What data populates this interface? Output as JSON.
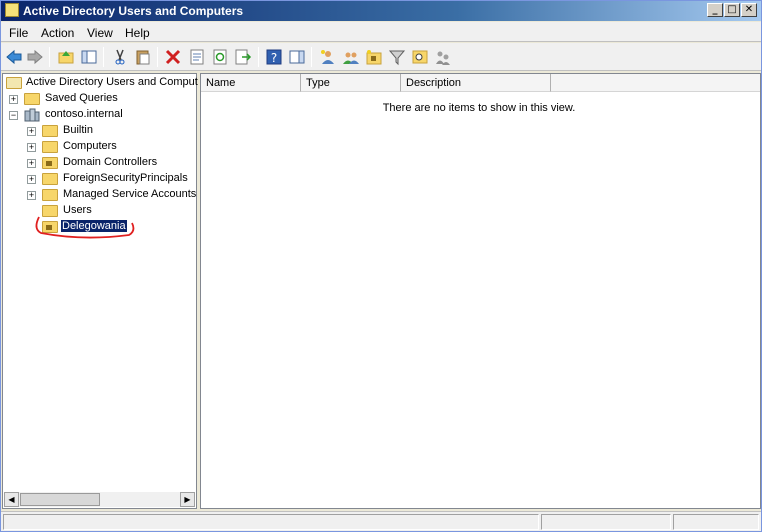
{
  "window": {
    "title": "Active Directory Users and Computers"
  },
  "titlebar_buttons": {
    "minimize": "_",
    "maximize": "□",
    "close": "✕"
  },
  "menu": [
    "File",
    "Action",
    "View",
    "Help"
  ],
  "toolbar": {
    "icons": [
      "back-icon",
      "forward-icon",
      "up-folder-icon",
      "show-hide-tree-icon",
      "cut-icon",
      "paste-icon",
      "delete-icon",
      "properties-icon",
      "refresh-icon",
      "export-list-icon",
      "help-icon",
      "show-action-pane-icon",
      "new-user-icon",
      "new-group-icon",
      "new-ou-icon",
      "filter-icon",
      "find-icon",
      "delegate-control-icon"
    ]
  },
  "tree": {
    "root": "Active Directory Users and Comput",
    "saved_queries": "Saved Queries",
    "domain": "contoso.internal",
    "children": [
      "Builtin",
      "Computers",
      "Domain Controllers",
      "ForeignSecurityPrincipals",
      "Managed Service Accounts",
      "Users",
      "Delegowania"
    ],
    "selected": "Delegowania"
  },
  "list": {
    "columns": [
      "Name",
      "Type",
      "Description"
    ],
    "empty_message": "There are no items to show in this view."
  },
  "colors": {
    "selection": "#0a246a",
    "annotation": "#e02020"
  }
}
